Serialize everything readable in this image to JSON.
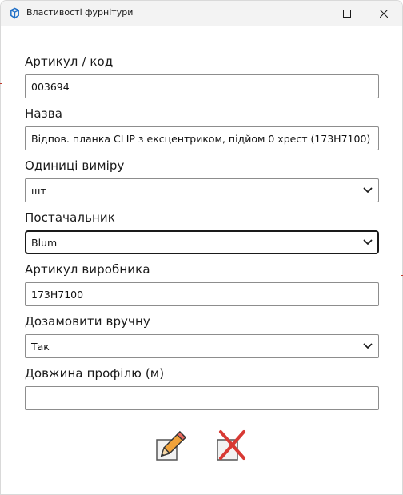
{
  "window": {
    "title": "Властивості фурнітури",
    "app_icon": "sketchup-icon",
    "controls": {
      "minimize": "minimize-icon",
      "maximize": "maximize-icon",
      "close": "close-icon"
    }
  },
  "form": {
    "article": {
      "label": "Артикул / код",
      "value": "003694"
    },
    "name": {
      "label": "Назва",
      "value": "Відпов. планка CLIP з ексцентриком, підйом 0 хрест (173H7100)"
    },
    "units": {
      "label": "Одиниці виміру",
      "selected": "шт"
    },
    "supplier": {
      "label": "Постачальник",
      "selected": "Blum"
    },
    "manufacturer_article": {
      "label": "Артикул виробника",
      "value": "173H7100"
    },
    "reorder_manually": {
      "label": "Дозамовити вручну",
      "selected": "Так"
    },
    "profile_length": {
      "label": "Довжина профілю (м)",
      "value": ""
    }
  },
  "actions": {
    "save": "pencil-icon",
    "cancel": "cross-icon"
  },
  "colors": {
    "titlebar": "#f3f3f3",
    "focus_border": "#1a1a1a",
    "pencil": "#f0a23a",
    "cross": "#d83a34"
  }
}
